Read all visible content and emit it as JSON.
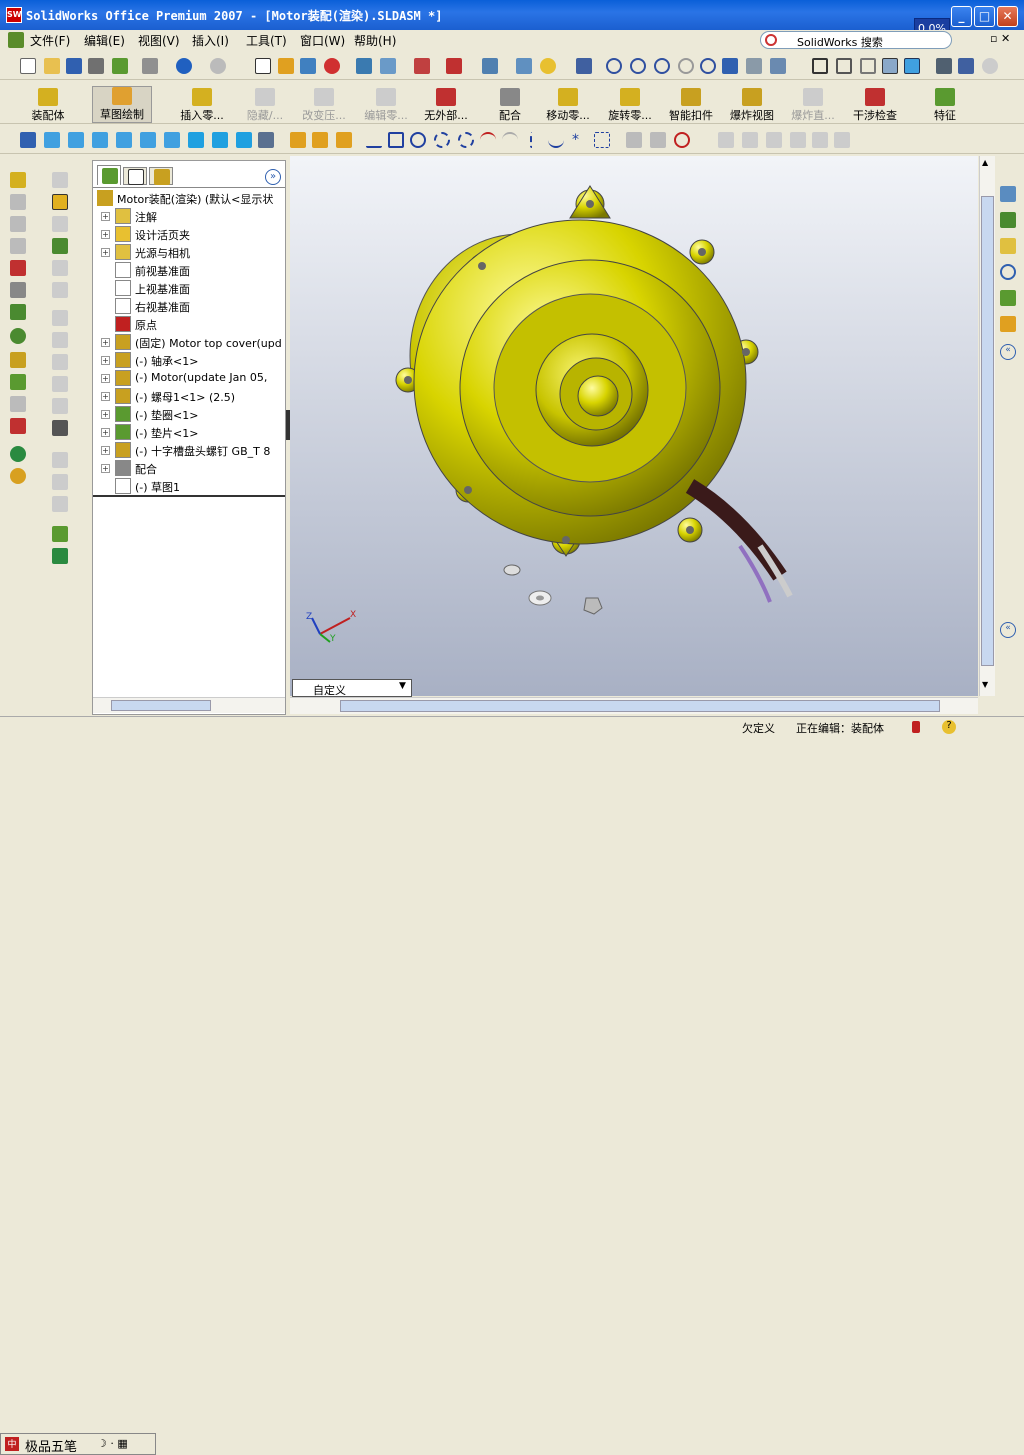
{
  "window": {
    "title": "SolidWorks Office Premium 2007 - [Motor装配(渲染).SLDASM *]",
    "logo": "SW",
    "progress": "0.0%"
  },
  "menu": [
    "文件(F)",
    "编辑(E)",
    "视图(V)",
    "插入(I)",
    "工具(T)",
    "窗口(W)",
    "帮助(H)"
  ],
  "search": {
    "placeholder": "SolidWorks 搜索"
  },
  "commandbar": [
    {
      "label": "装配体",
      "dim": false
    },
    {
      "label": "草图绘制",
      "dim": false
    },
    {
      "label": "插入零...",
      "dim": false
    },
    {
      "label": "隐藏/...",
      "dim": true
    },
    {
      "label": "改变压...",
      "dim": true
    },
    {
      "label": "编辑零...",
      "dim": true
    },
    {
      "label": "无外部...",
      "dim": false
    },
    {
      "label": "配合",
      "dim": false
    },
    {
      "label": "移动零...",
      "dim": false
    },
    {
      "label": "旋转零...",
      "dim": false
    },
    {
      "label": "智能扣件",
      "dim": false
    },
    {
      "label": "爆炸视图",
      "dim": false
    },
    {
      "label": "爆炸直...",
      "dim": true
    },
    {
      "label": "干涉检查",
      "dim": false
    },
    {
      "label": "特征",
      "dim": false
    }
  ],
  "tree": {
    "root": "Motor装配(渲染)  (默认<显示状",
    "items": [
      {
        "label": "注解",
        "plus": true
      },
      {
        "label": "设计活页夹",
        "plus": true
      },
      {
        "label": "光源与相机",
        "plus": true
      },
      {
        "label": "前视基准面",
        "plus": false
      },
      {
        "label": "上视基准面",
        "plus": false
      },
      {
        "label": "右视基准面",
        "plus": false
      },
      {
        "label": "原点",
        "plus": false
      },
      {
        "label": "(固定) Motor top cover(upd",
        "plus": true
      },
      {
        "label": "(-) 轴承<1>",
        "plus": true
      },
      {
        "label": "(-) Motor(update Jan 05,",
        "plus": true
      },
      {
        "label": "(-) 螺母1<1> (2.5)",
        "plus": true
      },
      {
        "label": "(-) 垫圈<1>",
        "plus": true
      },
      {
        "label": "(-) 垫片<1>",
        "plus": true
      },
      {
        "label": "(-) 十字槽盘头螺钉 GB_T 8",
        "plus": true
      },
      {
        "label": "配合",
        "plus": true
      },
      {
        "label": "(-) 草图1",
        "plus": false
      }
    ]
  },
  "viewport": {
    "view_name": "自定义",
    "triad": {
      "x": "X",
      "y": "Y",
      "z": "Z"
    }
  },
  "status": {
    "ime": "极品五笔",
    "state": "欠定义",
    "editing": "正在编辑：装配体"
  },
  "colors": {
    "title": "#0a5fd8",
    "motor": "#d8d400",
    "viewport_top": "#f2f4f8",
    "viewport_bottom": "#a8b0c4"
  }
}
